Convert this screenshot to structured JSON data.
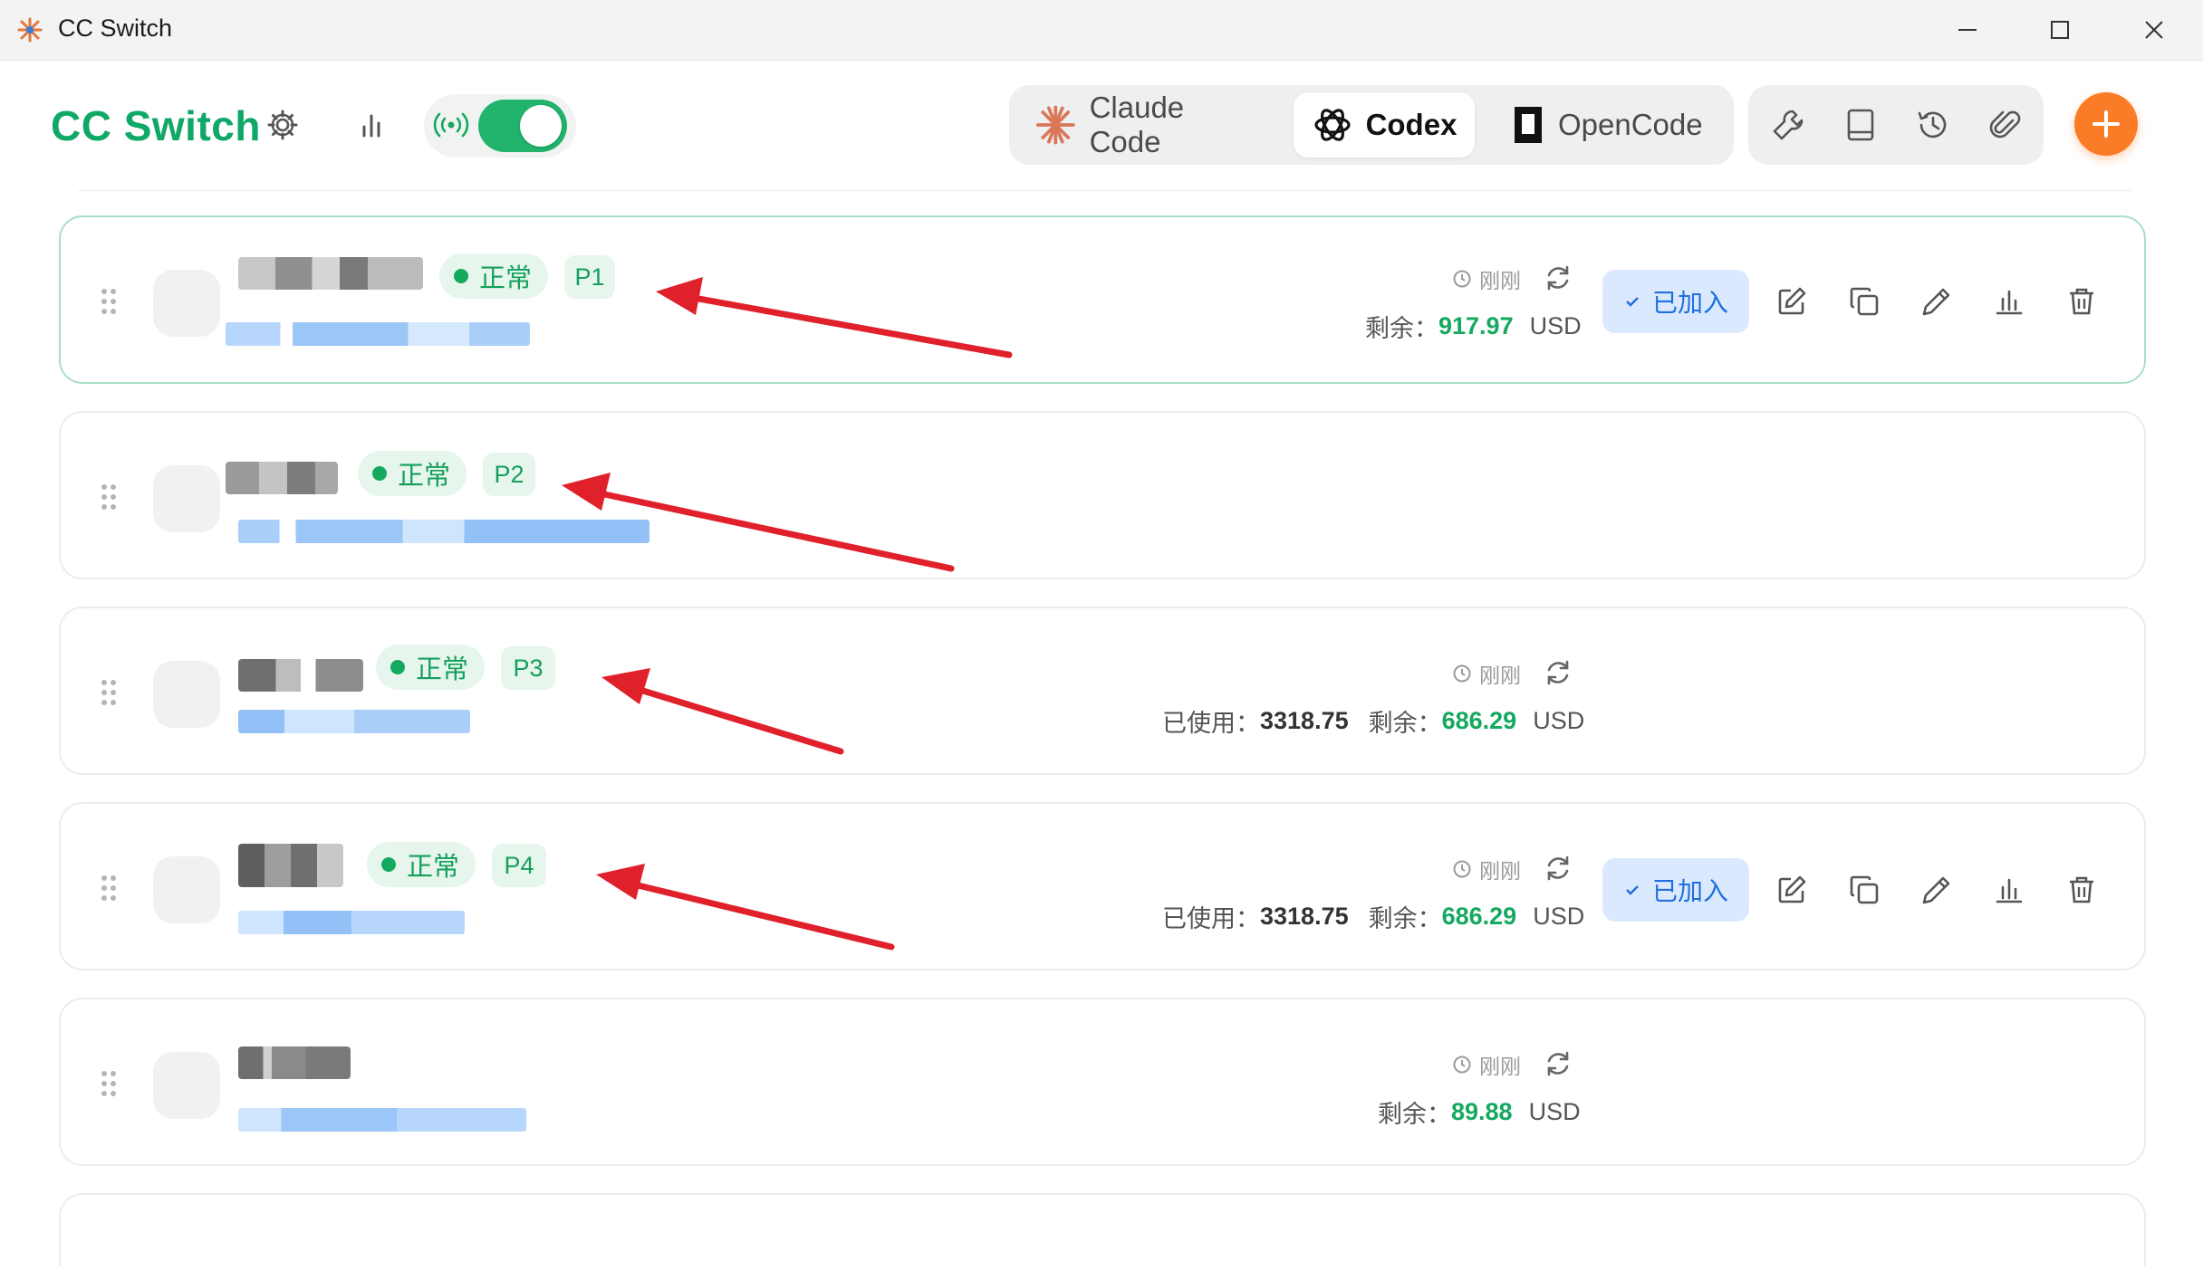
{
  "window": {
    "title": "CC Switch"
  },
  "header": {
    "brand": "CC Switch",
    "icons": [
      "gear-icon",
      "bar-chart-icon",
      "broadcast-icon"
    ],
    "proxy_toggle_on": true
  },
  "apps": {
    "tabs": [
      {
        "label": "Claude Code",
        "active": false
      },
      {
        "label": "Codex",
        "active": true
      },
      {
        "label": "OpenCode",
        "active": false
      }
    ]
  },
  "toolbar": {
    "icons": [
      "wrench-icon",
      "book-icon",
      "history-icon",
      "paperclip-icon",
      "plus-icon"
    ]
  },
  "labels": {
    "status_ok": "正常",
    "time_just_now": "刚刚",
    "remaining": "剩余：",
    "used": "已使用：",
    "currency": "USD",
    "joined": "已加入"
  },
  "providers": [
    {
      "priority": "P1",
      "status": "正常",
      "active": true,
      "used": null,
      "remaining": "917.97",
      "joined": true
    },
    {
      "priority": "P2",
      "status": "正常",
      "active": false,
      "used": null,
      "remaining": null,
      "joined": false
    },
    {
      "priority": "P3",
      "status": "正常",
      "active": false,
      "used": "3318.75",
      "remaining": "686.29",
      "joined": false
    },
    {
      "priority": "P4",
      "status": "正常",
      "active": false,
      "used": "3318.75",
      "remaining": "686.29",
      "joined": true
    },
    {
      "priority": null,
      "status": null,
      "active": false,
      "used": null,
      "remaining": "89.88",
      "joined": false
    }
  ],
  "colors": {
    "brand": "#10a867",
    "accent": "#fb7c26",
    "status_green": "#15a95f",
    "joined_blue": "#1f6fe0",
    "annotation_red": "#e0202a"
  }
}
